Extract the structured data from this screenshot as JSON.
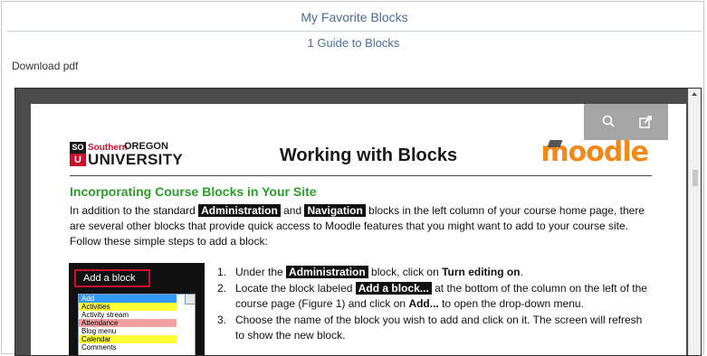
{
  "header": {
    "title": "My Favorite Blocks"
  },
  "guide": {
    "label": "1 Guide to Blocks"
  },
  "download": {
    "label": "Download pdf"
  },
  "viewer": {
    "toolbar": {
      "zoom_icon": "search-icon",
      "popout_icon": "external-link-icon"
    },
    "document": {
      "sou_logo": {
        "so": "SO",
        "southern": "Southern",
        "oregon": "OREGON",
        "u": "U",
        "university": "UNIVERSITY"
      },
      "title": "Working with Blocks",
      "moodle_logo": "moodle",
      "section_heading": "Incorporating Course Blocks in Your Site",
      "intro": {
        "t1": "In addition to the standard ",
        "h1": "Administration",
        "t2": " and ",
        "h2": "Navigation",
        "t3": " blocks in the left column of your course home page, there are several other blocks that provide quick access to Moodle features that you might want to add to your course site. Follow these simple steps to add a block:"
      },
      "screenshot": {
        "add_block_label": "Add a block",
        "items": [
          {
            "label": "Add",
            "bg": "#3399ff",
            "color": "#ffffff"
          },
          {
            "label": "Activities",
            "bg": "#ffff33",
            "color": "#000000"
          },
          {
            "label": "Activity stream",
            "bg": "#ffffff",
            "color": "#000000"
          },
          {
            "label": "Attendance",
            "bg": "#f4a0a0",
            "color": "#000000"
          },
          {
            "label": "Blog menu",
            "bg": "#ffffff",
            "color": "#000000"
          },
          {
            "label": "Calendar",
            "bg": "#ffff33",
            "color": "#000000"
          },
          {
            "label": "Comments",
            "bg": "#ffffff",
            "color": "#000000"
          }
        ]
      },
      "steps": [
        {
          "num": "1.",
          "t1": "Under the ",
          "h1": "Administration",
          "t2": " block, click on ",
          "b1": "Turn editing on",
          "t3": "."
        },
        {
          "num": "2.",
          "t1": "Locate the block labeled ",
          "h1": "Add a block...",
          "t2": " at the bottom of the column on the left of the course page (Figure 1) and click on ",
          "b1": "Add...",
          "t3": " to open the drop-down menu."
        },
        {
          "num": "3.",
          "t1": "Choose the name of the block you wish to add and click on it. The screen will refresh to show the new block.",
          "h1": "",
          "t2": "",
          "b1": "",
          "t3": ""
        }
      ]
    }
  },
  "colors": {
    "link": "#4a6d9a",
    "heading_green": "#2a9d2a",
    "moodle_orange": "#f08a1a",
    "sou_red": "#c8102e"
  }
}
